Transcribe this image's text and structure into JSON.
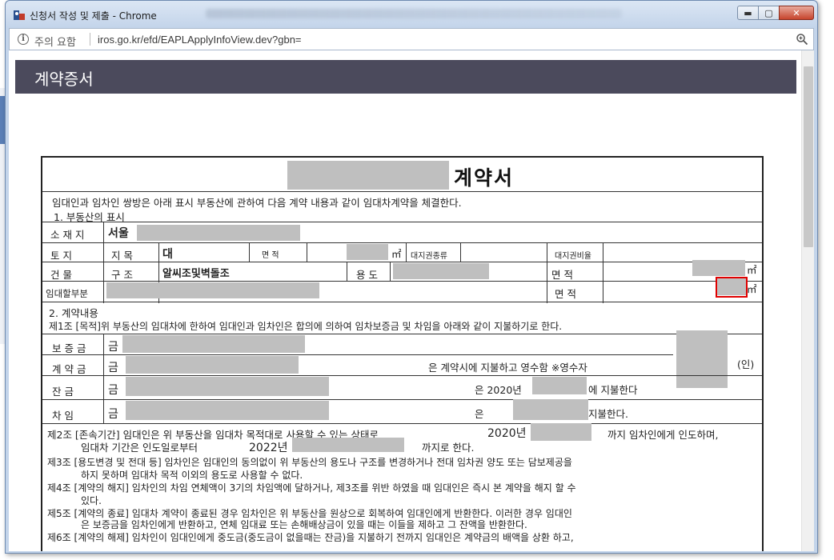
{
  "window": {
    "title": "신청서 작성 및 제출 - Chrome",
    "minimize_label": "▬",
    "maximize_label": "▢",
    "close_label": "✕"
  },
  "address_bar": {
    "security_warning": "주의 요함",
    "url": "iros.go.kr/efd/EAPLApplyInfoView.dev?gbn="
  },
  "page": {
    "header_title": "계약증서"
  },
  "document": {
    "title": "계약서",
    "intro": "임대인과 임차인 쌍방은 아래 표시 부동산에 관하여 다음 계약 내용과 같이 임대차계약을 체결한다.",
    "section1": "1. 부동산의 표시",
    "location_label": "소 재 지",
    "location_value": "서울",
    "land_label": "토    지",
    "land_type_label": "지    목",
    "land_type_value": "대",
    "area_label_1": "면    적",
    "sqm_unit": "㎡",
    "land_right_type_label": "대지권종류",
    "land_right_ratio_label": "대지권비율",
    "building_label": "건    물",
    "structure_label": "구    조",
    "structure_value": "알씨조및벽돌조",
    "usage_label": "용  도",
    "area_label_2": "면    적",
    "lease_part_label": "임대할부분",
    "area_label_3": "면    적",
    "section2": "2. 계약내용",
    "article1": "제1조 [목적]위 부동산의 임대차에 한하여 임대인과 임차인은 합의에 의하여 임차보증금 및 차임을 아래와 같이 지불하기로 한다.",
    "deposit_label": "보 증 금",
    "down_payment_label": "계 약 금",
    "balance_label": "잔    금",
    "rent_label": "차    임",
    "won_prefix": "금",
    "down_payment_text": "은 계약시에 지불하고 영수함 ※영수자",
    "seal_label": "(인)",
    "balance_text_1": "은 2020년",
    "balance_text_2": "에 지불한다",
    "rent_text_1": "은",
    "rent_text_2": "지불한다.",
    "article2_line1a": "제2조 [존속기간] 임대인은 위 부동산을 임대차 목적대로 사용할 수 있는 상태로",
    "article2_year1": "2020년",
    "article2_line1b": "까지 임차인에게 인도하며,",
    "article2_line2a": "임대차 기간은 인도일로부터",
    "article2_year2": "2022년",
    "article2_line2b": "까지로 한다.",
    "article3_line1": "제3조 [용도변경 및 전대 등] 임차인은 임대인의 동의없이 위 부동산의 용도나 구조를 변경하거나 전대 임차권 양도 또는 담보제공을",
    "article3_line2": "하지 못하며 임대차 목적 이외의 용도로 사용할 수 없다.",
    "article4_line1": "제4조 [계약의 해지] 임차인의 차임 연체액이 3기의 차임액에 달하거나, 제3조를 위반 하였을 때 임대인은 즉시 본 계약을 해지 할 수",
    "article4_line2": "있다.",
    "article5_line1": "제5조 [계약의 종료] 임대차 계약이 종료된 경우 임차인은 위 부동산을 원상으로 회복하여 임대인에게 반환한다. 이러한 경우 임대인",
    "article5_line2": "은 보증금을 임차인에게 반환하고, 연체 임대료 또는 손해배상금이 있을 때는 이들을 제하고 그 잔액을 반환한다.",
    "article6_line1": "제6조 [계약의 해제] 임차인이 임대인에게 중도금(중도금이 없을때는 잔금)을 지불하기 전까지 임대인은 계약금의 배액을 상환 하고,"
  },
  "colors": {
    "header_bar": "#4b4a5c",
    "redaction": "#bfbfbf",
    "highlight": "#e00000",
    "window_frame": "#c3d4ea"
  },
  "icons": {
    "app": "chrome-app-icon",
    "info": "info-icon",
    "zoom": "zoom-icon"
  }
}
